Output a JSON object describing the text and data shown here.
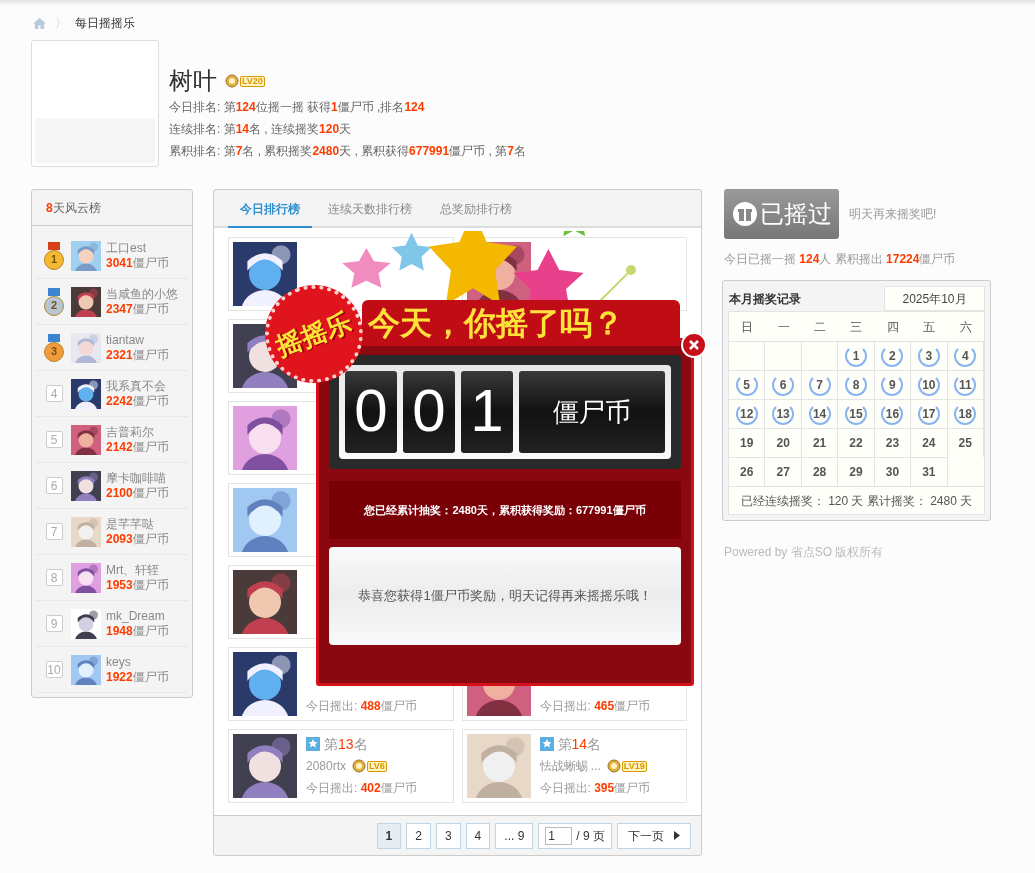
{
  "breadcrumb": {
    "separator": "〉",
    "current": "每日摇摇乐"
  },
  "profile": {
    "name": "树叶",
    "level": "LV20",
    "lines": [
      "今日排名: 第**124**位摇一摇 获得**1**僵尸币 ,排名**124**",
      "连续排名: 第**14**名 , 连续摇奖**120**天",
      "累积排名: 第**7**名 , 累积摇奖**2480**天 , 累积获得**677991**僵尸币 , 第**7**名"
    ]
  },
  "leaderboard": {
    "title_number": "8",
    "title": "天风云榜",
    "items": [
      {
        "rank": "1",
        "kind": "medal",
        "color": "#f5b82e",
        "name": "工口est",
        "amount": "3041",
        "unit": "僵尸币"
      },
      {
        "rank": "2",
        "kind": "medal",
        "color": "#b7c6d3",
        "name": "当咸鱼的小悠",
        "amount": "2347",
        "unit": "僵尸币"
      },
      {
        "rank": "3",
        "kind": "medal",
        "color": "#f29b3c",
        "name": "tiantaw",
        "amount": "2321",
        "unit": "僵尸币"
      },
      {
        "rank": "4",
        "kind": "plain",
        "name": "我系真不会",
        "amount": "2242",
        "unit": "僵尸币"
      },
      {
        "rank": "5",
        "kind": "plain",
        "name": "吉普莉尔",
        "amount": "2142",
        "unit": "僵尸币"
      },
      {
        "rank": "6",
        "kind": "plain",
        "name": "摩卡咖啡喵",
        "amount": "2100",
        "unit": "僵尸币"
      },
      {
        "rank": "7",
        "kind": "plain",
        "name": "是芊芊哒",
        "amount": "2093",
        "unit": "僵尸币"
      },
      {
        "rank": "8",
        "kind": "plain",
        "name": "Mrt、轩轾",
        "amount": "1953",
        "unit": "僵尸币"
      },
      {
        "rank": "9",
        "kind": "plain",
        "name": "mk_Dream",
        "amount": "1948",
        "unit": "僵尸币"
      },
      {
        "rank": "10",
        "kind": "plain",
        "name": "keys",
        "amount": "1922",
        "unit": "僵尸币"
      }
    ]
  },
  "tabs": [
    {
      "label": "今日排行榜",
      "selected": true
    },
    {
      "label": "连续天数排行榜",
      "selected": false
    },
    {
      "label": "总奖励排行榜",
      "selected": false
    }
  ],
  "cards": [
    {
      "kind": "covered"
    },
    {
      "kind": "covered"
    },
    {
      "kind": "covered"
    },
    {
      "kind": "hidden"
    },
    {
      "kind": "covered"
    },
    {
      "kind": "hidden"
    },
    {
      "kind": "covered"
    },
    {
      "kind": "hidden"
    },
    {
      "kind": "covered"
    },
    {
      "kind": "covered"
    },
    {
      "kind": "amount_only",
      "label": "今日摇出:",
      "amount": "488",
      "unit": "僵尸币"
    },
    {
      "kind": "amount_only",
      "label": "今日摇出:",
      "amount": "465",
      "unit": "僵尸币"
    },
    {
      "kind": "full",
      "rank_prefix": "第",
      "rank": "13",
      "rank_suffix": "名",
      "name": "2080rtx",
      "level": "LV6",
      "label": "今日摇出:",
      "amount": "402",
      "unit": "僵尸币"
    },
    {
      "kind": "full",
      "rank_prefix": "第",
      "rank": "14",
      "rank_suffix": "名",
      "name": "怯战蜥蜴 ...",
      "level": "LV19",
      "label": "今日摇出:",
      "amount": "395",
      "unit": "僵尸币"
    }
  ],
  "pagination": {
    "pages": [
      {
        "label": "1",
        "selected": true
      },
      {
        "label": "2",
        "selected": false
      },
      {
        "label": "3",
        "selected": false
      },
      {
        "label": "4",
        "selected": false
      },
      {
        "label": "... 9",
        "selected": false
      }
    ],
    "jump_value": "1",
    "total": "/ 9 页",
    "next": "下一页"
  },
  "shake": {
    "button": "已摇过",
    "hint": "明天再来摇奖吧!",
    "stats": "今日已摇一摇 **124**人 累积摇出 **17224**僵尸币"
  },
  "calendar": {
    "title": "本月摇奖记录",
    "month": "2025年10月",
    "weekdays": [
      "日",
      "一",
      "二",
      "三",
      "四",
      "五",
      "六"
    ],
    "days": [
      {
        "kind": "blank"
      },
      {
        "kind": "blank"
      },
      {
        "kind": "blank"
      },
      {
        "day": "1",
        "signed": true
      },
      {
        "day": "2",
        "signed": true
      },
      {
        "day": "3",
        "signed": true
      },
      {
        "day": "4",
        "signed": true
      },
      {
        "day": "5",
        "signed": true
      },
      {
        "day": "6",
        "signed": true
      },
      {
        "day": "7",
        "signed": true
      },
      {
        "day": "8",
        "signed": true
      },
      {
        "day": "9",
        "signed": true
      },
      {
        "day": "10",
        "signed": true
      },
      {
        "day": "11",
        "signed": true
      },
      {
        "day": "12",
        "signed": true
      },
      {
        "day": "13",
        "signed": true
      },
      {
        "day": "14",
        "signed": true
      },
      {
        "day": "15",
        "signed": true
      },
      {
        "day": "16",
        "signed": true
      },
      {
        "day": "17",
        "signed": true
      },
      {
        "day": "18",
        "signed": true
      },
      {
        "day": "19",
        "signed": false
      },
      {
        "day": "20",
        "signed": false
      },
      {
        "day": "21",
        "signed": false
      },
      {
        "day": "22",
        "signed": false
      },
      {
        "day": "23",
        "signed": false
      },
      {
        "day": "24",
        "signed": false
      },
      {
        "day": "25",
        "signed": false
      },
      {
        "day": "26",
        "signed": false
      },
      {
        "day": "27",
        "signed": false
      },
      {
        "day": "28",
        "signed": false
      },
      {
        "day": "29",
        "signed": false
      },
      {
        "day": "30",
        "signed": false
      },
      {
        "day": "31",
        "signed": false
      }
    ],
    "summary": "已经连续摇奖： 120 天 累计摇奖： 2480 天"
  },
  "footer": "Powered by 省点SO 版权所有",
  "popup": {
    "badge": "摇摇乐",
    "banner": "今天，你摇了吗？",
    "digits": [
      "0",
      "0",
      "1"
    ],
    "unit": "僵尸币",
    "summary": "您已经累计抽奖：2480天，累积获得奖励：677991僵尸币",
    "message": "恭喜您获得1僵尸币奖励，明天记得再来摇摇乐哦！"
  }
}
